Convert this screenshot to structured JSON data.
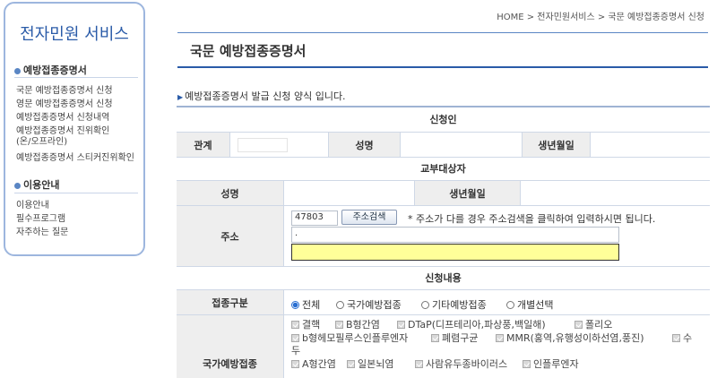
{
  "sidebar": {
    "title": "전자민원 서비스",
    "section1": "예방접종증명서",
    "links1": [
      "국문 예방접종증명서 신청",
      "영문 예방접종증명서 신청",
      "예방접종증명서 신청내역",
      "예방접종증명서 진위확인",
      "(온/오프라인)",
      "예방접종증명서 스티커진위확인"
    ],
    "section2": "이용안내",
    "links2": [
      "이용안내",
      "필수프로그램",
      "자주하는 질문"
    ]
  },
  "breadcrumb": "HOME > 전자민원서비스 > 국문 예방접종증명서 신청",
  "page_title": "국문 예방접종증명서",
  "description": "예방접종증명서 발급 신청 양식 입니다.",
  "applicant": {
    "header": "신청인",
    "relation_label": "관계",
    "name_label": "성명",
    "birth_label": "생년월일"
  },
  "recipient": {
    "header": "교부대상자",
    "name_label": "성명",
    "birth_label": "생년월일",
    "address_label": "주소",
    "zipcode": "47803",
    "search_button": "주소검색",
    "address_note": "* 주소가 다를 경우 주소검색을 클릭하여 입력하시면 됩니다.",
    "address_line1": "."
  },
  "request": {
    "header": "신청내용",
    "type_label": "접종구분",
    "type_options": [
      "전체",
      "국가예방접종",
      "기타예방접종",
      "개별선택"
    ],
    "selected_type": "전체",
    "national_label": "국가예방접종",
    "vaccines_line1": [
      "결핵",
      "B형간염",
      "DTaP(디프테리아,파상풍,백일해)",
      "폴리오"
    ],
    "vaccines_line2": [
      "b형헤모필루스인플루엔자",
      "폐렴구균",
      "MMR(홍역,유행성이하선염,풍진)",
      "수"
    ],
    "vaccines_line2_wrap": "두",
    "vaccines_line3": [
      "A형간염",
      "일본뇌염",
      "사람유두종바이러스",
      "인플루엔자"
    ]
  },
  "colors": {
    "accent": "#2a5ba8",
    "highlight": "#ffff99"
  }
}
